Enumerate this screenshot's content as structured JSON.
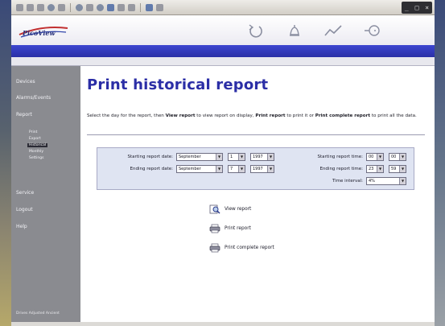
{
  "app": {
    "logo_text": "PicoView",
    "window_controls": [
      "_",
      "□",
      "×"
    ]
  },
  "nav": {
    "items": [
      {
        "label": "Devices"
      },
      {
        "label": "Alarms/Events"
      },
      {
        "label": "Report"
      },
      {
        "label": "Service"
      },
      {
        "label": "Logout"
      },
      {
        "label": "Help"
      }
    ],
    "report_subitems": [
      {
        "label": "Print"
      },
      {
        "label": "Export"
      },
      {
        "label": "Historical"
      },
      {
        "label": "Monthly"
      },
      {
        "label": "Settings"
      }
    ],
    "active_sub": "Historical",
    "footer": "Drives Adjusted Ancient"
  },
  "page": {
    "title": "Print historical report",
    "instructions": {
      "p1": "Select the day for the report, then ",
      "b1": "View report",
      "p2": " to view report on display, ",
      "b2": "Print report",
      "p3": " to print it or ",
      "b3": "Print complete report",
      "p4": " to print all the data."
    }
  },
  "form": {
    "start_date_label": "Starting report date:",
    "end_date_label": "Ending report date:",
    "start_time_label": "Starting report time:",
    "end_time_label": "Ending report time:",
    "interval_label": "Time interval:",
    "start_date": {
      "month": "September",
      "day": "1",
      "year": "1997"
    },
    "end_date": {
      "month": "September",
      "day": "7",
      "year": "1997"
    },
    "start_time": {
      "hour": "00",
      "minute": "00"
    },
    "end_time": {
      "hour": "23",
      "minute": "59"
    },
    "interval": "4%"
  },
  "actions": {
    "view": "View report",
    "print": "Print report",
    "print_complete": "Print complete report"
  }
}
